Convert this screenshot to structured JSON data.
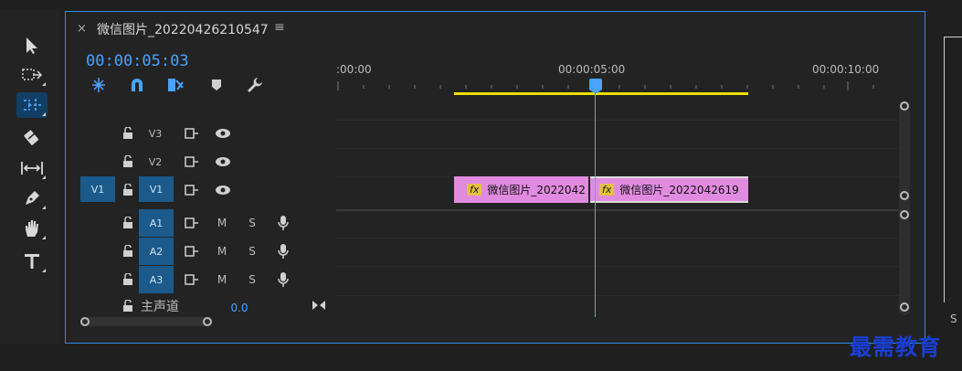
{
  "sequence": {
    "close_label": "×",
    "title": "微信图片_20220426210547",
    "menu_label": "≡",
    "timecode": "00:00:05:03",
    "ruler_labels": [
      ":00:00",
      "00:00:05:00",
      "00:00:10:00"
    ]
  },
  "tracks": {
    "video": [
      {
        "target": "",
        "name": "V3"
      },
      {
        "target": "",
        "name": "V2"
      },
      {
        "target": "V1",
        "name": "V1"
      }
    ],
    "audio": [
      {
        "name": "A1",
        "m": "M",
        "s": "S"
      },
      {
        "name": "A2",
        "m": "M",
        "s": "S"
      },
      {
        "name": "A3",
        "m": "M",
        "s": "S"
      }
    ],
    "master": {
      "label": "主声道",
      "value": "0.0"
    }
  },
  "clips": [
    {
      "fx": "fx",
      "label": "微信图片_2022042"
    },
    {
      "fx": "fx",
      "label": "微信图片_2022042619"
    }
  ],
  "tools": [
    "selection-tool",
    "track-select-tool",
    "ripple-edit-tool",
    "razor-tool",
    "slip-tool",
    "pen-tool",
    "hand-tool",
    "type-tool"
  ],
  "right_panel_label": "S",
  "watermark": "最需教育",
  "colors": {
    "accent": "#4aa3ff",
    "clip": "#e18be0",
    "workarea": "#f0e000",
    "target": "#1b5a8a"
  }
}
